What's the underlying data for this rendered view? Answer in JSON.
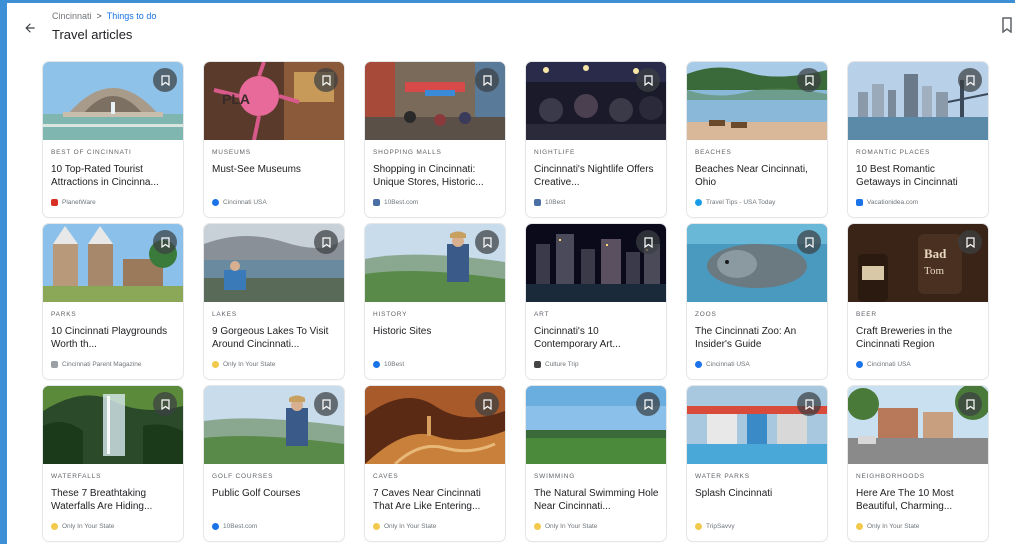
{
  "header": {
    "breadcrumb": [
      "Cincinnati",
      "Things to do"
    ],
    "breadcrumb_sep": ">",
    "title": "Travel articles"
  },
  "icons": {
    "back": "arrow-back-icon",
    "save": "bookmark-icon",
    "top_right": "bookmark-outline-icon"
  },
  "colors": {
    "frame": "#3d8fd6",
    "link": "#1a73e8",
    "save_button": "#3c4043"
  },
  "articles": [
    {
      "category": "BEST OF CINCINNATI",
      "title": "10 Top-Rated Tourist Attractions in Cincinna...",
      "source": "PlanetWare",
      "fav": "#d93025"
    },
    {
      "category": "MUSEUMS",
      "title": "Must-See Museums",
      "source": "Cincinnati USA",
      "fav": "#1a73e8"
    },
    {
      "category": "SHOPPING MALLS",
      "title": "Shopping in Cincinnati: Unique Stores, Historic...",
      "source": "10Best.com",
      "fav": "#4a6fa5"
    },
    {
      "category": "NIGHTLIFE",
      "title": "Cincinnati's Nightlife Offers Creative...",
      "source": "10Best",
      "fav": "#4a6fa5"
    },
    {
      "category": "BEACHES",
      "title": "Beaches Near Cincinnati, Ohio",
      "source": "Travel Tips - USA Today",
      "fav": "#1a9be8"
    },
    {
      "category": "ROMANTIC PLACES",
      "title": "10 Best Romantic Getaways in Cincinnati",
      "source": "Vacationidea.com",
      "fav": "#1a73e8"
    },
    {
      "category": "PARKS",
      "title": "10 Cincinnati Playgrounds Worth th...",
      "source": "Cincinnati Parent Magazine",
      "fav": "#9aa0a6"
    },
    {
      "category": "LAKES",
      "title": "9 Gorgeous Lakes To Visit Around Cincinnati...",
      "source": "Only In Your State",
      "fav": "#f2c94c"
    },
    {
      "category": "HISTORY",
      "title": "Historic Sites",
      "source": "10Best",
      "fav": "#1a73e8"
    },
    {
      "category": "ART",
      "title": "Cincinnati's 10 Contemporary Art...",
      "source": "Culture Trip",
      "fav": "#444444"
    },
    {
      "category": "ZOOS",
      "title": "The Cincinnati Zoo: An Insider's Guide",
      "source": "Cincinnati USA",
      "fav": "#1a73e8"
    },
    {
      "category": "BEER",
      "title": "Craft Breweries in the Cincinnati Region",
      "source": "Cincinnati USA",
      "fav": "#1a73e8"
    },
    {
      "category": "WATERFALLS",
      "title": "These 7 Breathtaking Waterfalls Are Hiding...",
      "source": "Only In Your State",
      "fav": "#f2c94c"
    },
    {
      "category": "GOLF COURSES",
      "title": "Public Golf Courses",
      "source": "10Best.com",
      "fav": "#1a73e8"
    },
    {
      "category": "CAVES",
      "title": "7 Caves Near Cincinnati That Are Like Entering...",
      "source": "Only In Your State",
      "fav": "#f2c94c"
    },
    {
      "category": "SWIMMING",
      "title": "The Natural Swimming Hole Near Cincinnati...",
      "source": "Only In Your State",
      "fav": "#f2c94c"
    },
    {
      "category": "WATER PARKS",
      "title": "Splash Cincinnati",
      "source": "TripSavvy",
      "fav": "#f2c94c"
    },
    {
      "category": "NEIGHBORHOODS",
      "title": "Here Are The 10 Most Beautiful, Charming...",
      "source": "Only In Your State",
      "fav": "#f2c94c"
    }
  ]
}
